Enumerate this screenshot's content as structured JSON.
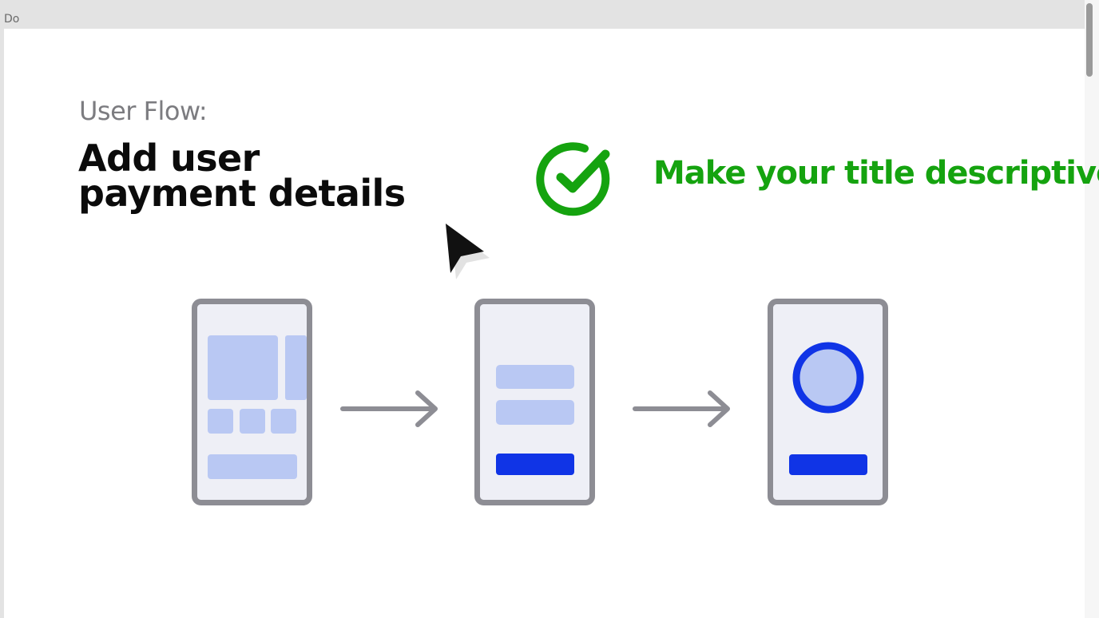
{
  "window": {
    "frame_label": "Do"
  },
  "slide": {
    "flow_label": "User Flow:",
    "title_line1": "Add user",
    "title_line2": "payment details",
    "tip": "Make your title descriptive"
  },
  "colors": {
    "tip_green": "#15a30f",
    "phone_frame": "#8d8d94",
    "phone_screen": "#eeeff6",
    "placeholder_block": "#b9c8f3",
    "primary_blue": "#1034e6"
  },
  "icons": {
    "check": "check-circle-icon",
    "cursor": "mouse-pointer-icon",
    "arrow": "arrow-right-icon"
  }
}
